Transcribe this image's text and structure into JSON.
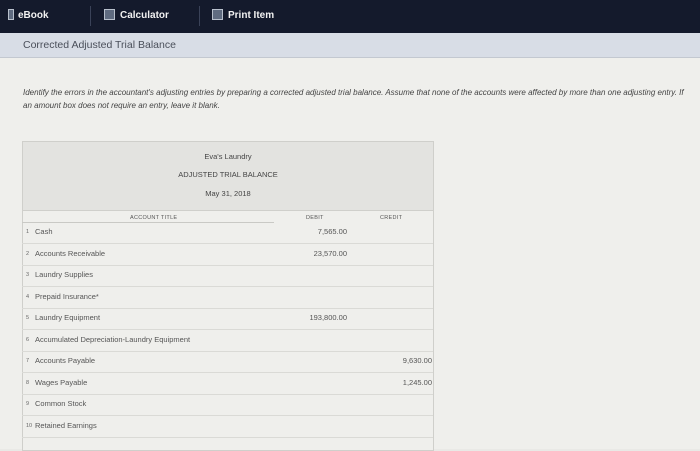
{
  "tabs": [
    {
      "label": "eBook"
    },
    {
      "label": "Calculator"
    },
    {
      "label": "Print Item"
    }
  ],
  "page_title": "Corrected Adjusted Trial Balance",
  "instructions": "Identify the errors in the accountant's adjusting entries by preparing a corrected adjusted trial balance. Assume that none of the accounts were affected by more than one adjusting entry. If an amount box does not require an entry, leave it blank.",
  "trial_balance": {
    "company": "Eva's Laundry",
    "title": "ADJUSTED TRIAL BALANCE",
    "date": "May 31, 2018",
    "headers": {
      "account": "ACCOUNT TITLE",
      "debit": "DEBIT",
      "credit": "CREDIT"
    },
    "rows": [
      {
        "num": "1",
        "account": "Cash",
        "debit": "7,565.00",
        "credit": ""
      },
      {
        "num": "2",
        "account": "Accounts Receivable",
        "debit": "23,570.00",
        "credit": ""
      },
      {
        "num": "3",
        "account": "Laundry Supplies",
        "debit": "",
        "credit": ""
      },
      {
        "num": "4",
        "account": "Prepaid Insurance*",
        "debit": "",
        "credit": ""
      },
      {
        "num": "5",
        "account": "Laundry Equipment",
        "debit": "193,800.00",
        "credit": ""
      },
      {
        "num": "6",
        "account": "Accumulated Depreciation-Laundry Equipment",
        "debit": "",
        "credit": ""
      },
      {
        "num": "7",
        "account": "Accounts Payable",
        "debit": "",
        "credit": "9,630.00"
      },
      {
        "num": "8",
        "account": "Wages Payable",
        "debit": "",
        "credit": "1,245.00"
      },
      {
        "num": "9",
        "account": "Common Stock",
        "debit": "",
        "credit": ""
      },
      {
        "num": "10",
        "account": "Retained Earnings",
        "debit": "",
        "credit": ""
      }
    ]
  }
}
